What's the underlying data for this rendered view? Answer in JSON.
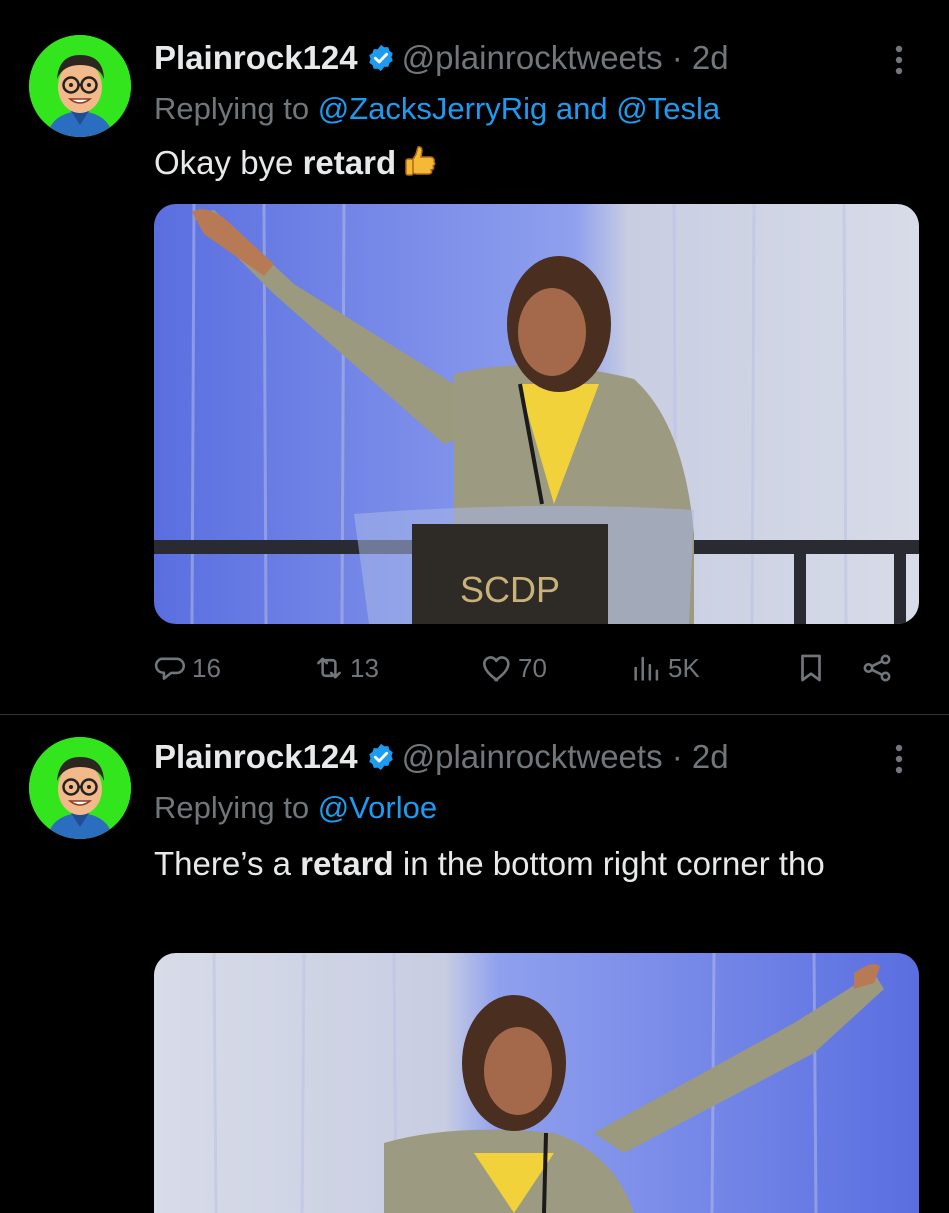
{
  "colors": {
    "background": "#000000",
    "text": "#e7e9ea",
    "muted": "#71767b",
    "link": "#1d9bf0",
    "verified": "#1d9bf0",
    "avatar_bg": "#33e51c"
  },
  "tweets": [
    {
      "name": "Plainrock124",
      "handle": "@plainrocktweets",
      "dot": "·",
      "time": "2d",
      "reply_prefix": "Replying to",
      "reply_mentions": [
        "@ZacksJerryRig",
        "@Tesla"
      ],
      "reply_joiner": "and",
      "text_before": "Okay bye ",
      "text_bold": "retard",
      "text_after": "",
      "emoji": "thumbs-up",
      "media_sign": "SCDP",
      "stats": {
        "replies": "16",
        "reposts": "13",
        "likes": "70",
        "views": "5K"
      }
    },
    {
      "name": "Plainrock124",
      "handle": "@plainrocktweets",
      "dot": "·",
      "time": "2d",
      "reply_prefix": "Replying to",
      "reply_mentions": [
        "@Vorloe"
      ],
      "text_before": "There’s a ",
      "text_bold": "retard",
      "text_after": " in the bottom right corner tho"
    }
  ]
}
